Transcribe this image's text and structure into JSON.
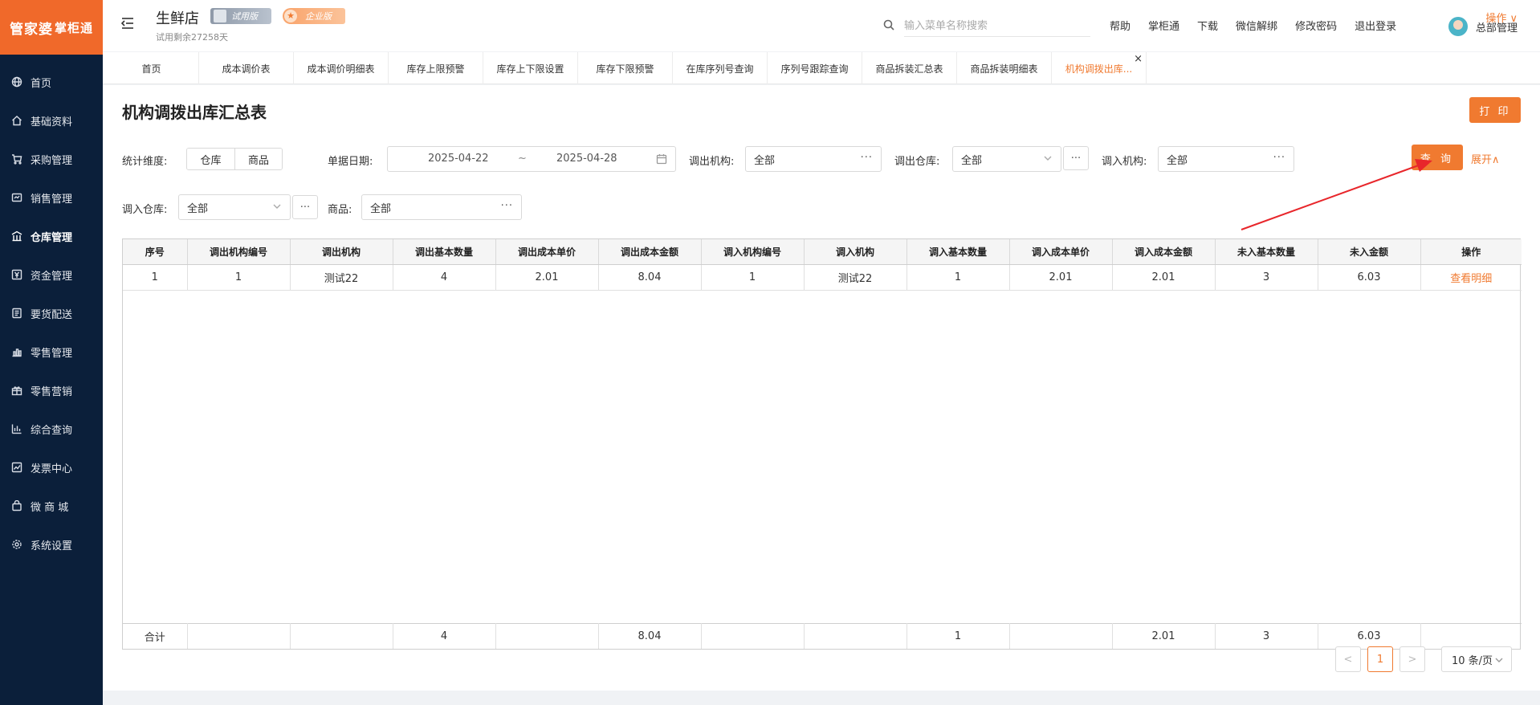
{
  "brand": {
    "logo_main": "管家婆",
    "logo_sub": "掌柜通"
  },
  "sidebar": {
    "items": [
      {
        "label": "首页",
        "icon": "globe-icon"
      },
      {
        "label": "基础资料",
        "icon": "home-icon"
      },
      {
        "label": "采购管理",
        "icon": "cart-icon"
      },
      {
        "label": "销售管理",
        "icon": "sales-icon"
      },
      {
        "label": "仓库管理",
        "icon": "warehouse-icon"
      },
      {
        "label": "资金管理",
        "icon": "money-icon"
      },
      {
        "label": "要货配送",
        "icon": "list-icon"
      },
      {
        "label": "零售管理",
        "icon": "chart-bar-icon"
      },
      {
        "label": "零售营销",
        "icon": "gift-icon"
      },
      {
        "label": "综合查询",
        "icon": "chart-icon"
      },
      {
        "label": "发票中心",
        "icon": "invoice-icon"
      },
      {
        "label": "微 商 城",
        "icon": "bag-icon"
      },
      {
        "label": "系统设置",
        "icon": "gear-icon"
      }
    ]
  },
  "header": {
    "store_name": "生鲜店",
    "trial_badge": "试用版",
    "enterprise_badge": "企业版",
    "trial_days": "试用剩余27258天",
    "search_placeholder": "输入菜单名称搜索",
    "links": [
      "帮助",
      "掌柜通",
      "下载",
      "微信解绑",
      "修改密码",
      "退出登录"
    ],
    "user_name": "总部管理"
  },
  "tabs": [
    {
      "label": "首页",
      "w": 118
    },
    {
      "label": "成本调价表",
      "w": 118
    },
    {
      "label": "成本调价明细表",
      "w": 118
    },
    {
      "label": "库存上限预警",
      "w": 118
    },
    {
      "label": "库存上下限设置",
      "w": 118
    },
    {
      "label": "库存下限预警",
      "w": 118
    },
    {
      "label": "在库序列号查询",
      "w": 118
    },
    {
      "label": "序列号跟踪查询",
      "w": 118
    },
    {
      "label": "商品拆装汇总表",
      "w": 118
    },
    {
      "label": "商品拆装明细表",
      "w": 118
    },
    {
      "label": "机构调拨出库...",
      "w": 118,
      "active": true
    }
  ],
  "tabs_ops": "操作 ∨",
  "page": {
    "title": "机构调拨出库汇总表",
    "print_label": "打 印",
    "query_label": "查 询",
    "expand_label": "展开∧"
  },
  "filters": {
    "dimension_label": "统计维度:",
    "dimension_options": [
      "仓库",
      "商品"
    ],
    "date_label": "单据日期:",
    "date_from": "2025-04-22",
    "date_sep": "~",
    "date_to": "2025-04-28",
    "out_org_label": "调出机构:",
    "out_org_value": "全部",
    "out_wh_label": "调出仓库:",
    "out_wh_value": "全部",
    "in_org_label": "调入机构:",
    "in_org_value": "全部",
    "in_wh_label": "调入仓库:",
    "in_wh_value": "全部",
    "goods_label": "商品:",
    "goods_value": "全部",
    "dots": "···"
  },
  "table": {
    "columns": [
      "序号",
      "调出机构编号",
      "调出机构",
      "调出基本数量",
      "调出成本单价",
      "调出成本金额",
      "调入机构编号",
      "调入机构",
      "调入基本数量",
      "调入成本单价",
      "调入成本金额",
      "未入基本数量",
      "未入金额",
      "操作"
    ],
    "rows": [
      [
        "1",
        "1",
        "测试22",
        "4",
        "2.01",
        "8.04",
        "1",
        "测试22",
        "1",
        "2.01",
        "2.01",
        "3",
        "6.03",
        "查看明细"
      ]
    ],
    "totals": [
      "合计",
      "",
      "",
      "4",
      "",
      "8.04",
      "",
      "",
      "1",
      "",
      "2.01",
      "3",
      "6.03",
      ""
    ]
  },
  "pagination": {
    "prev": "<",
    "current": "1",
    "next": ">",
    "page_size": "10 条/页"
  },
  "colors": {
    "accent": "#f07a30",
    "sidebar_bg": "#0b1f3a"
  }
}
